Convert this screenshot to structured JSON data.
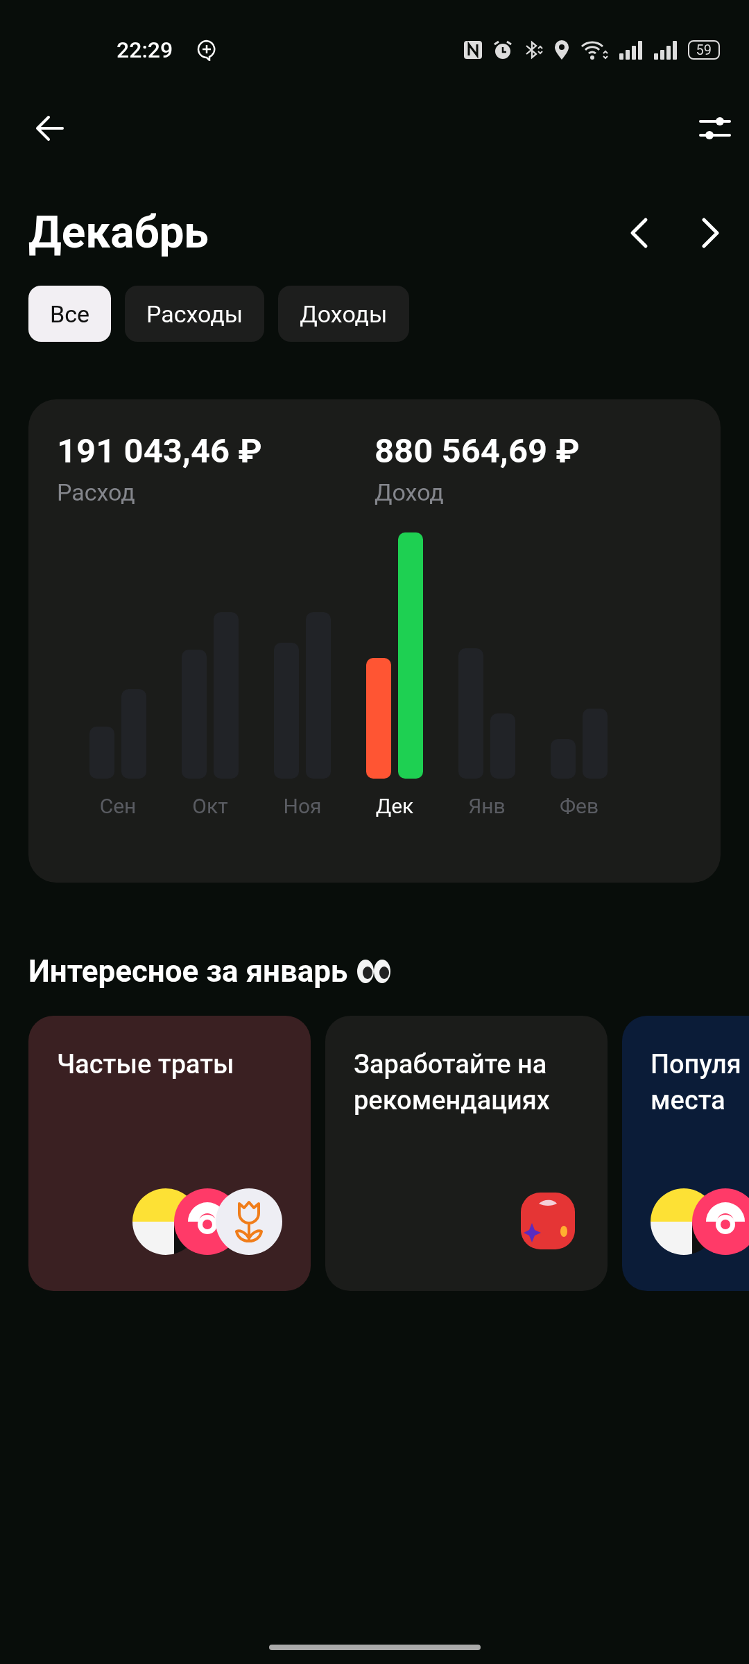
{
  "status_bar": {
    "time": "22:29",
    "battery": "59"
  },
  "title": "Декабрь",
  "filters": [
    {
      "label": "Все",
      "selected": true
    },
    {
      "label": "Расходы",
      "selected": false
    },
    {
      "label": "Доходы",
      "selected": false
    }
  ],
  "summary": {
    "totals": [
      {
        "amount": "191 043,46 ₽",
        "label": "Расход"
      },
      {
        "amount": "880 564,69 ₽",
        "label": "Доход"
      }
    ],
    "months": [
      {
        "label": "Сен",
        "selected": false
      },
      {
        "label": "Окт",
        "selected": false
      },
      {
        "label": "Ноя",
        "selected": false
      },
      {
        "label": "Дек",
        "selected": true
      },
      {
        "label": "Янв",
        "selected": false
      },
      {
        "label": "Фев",
        "selected": false
      }
    ]
  },
  "section_title": "Интересное за январь",
  "cards": [
    {
      "kind": "merchants",
      "title": "Частые траты",
      "color": "#3a2022"
    },
    {
      "kind": "offer",
      "title": "Заработайте на\nрекомендациях",
      "color": "#1b1c1a"
    },
    {
      "kind": "places",
      "title": "Популя\nместа",
      "color": "#0b1c38"
    }
  ]
}
